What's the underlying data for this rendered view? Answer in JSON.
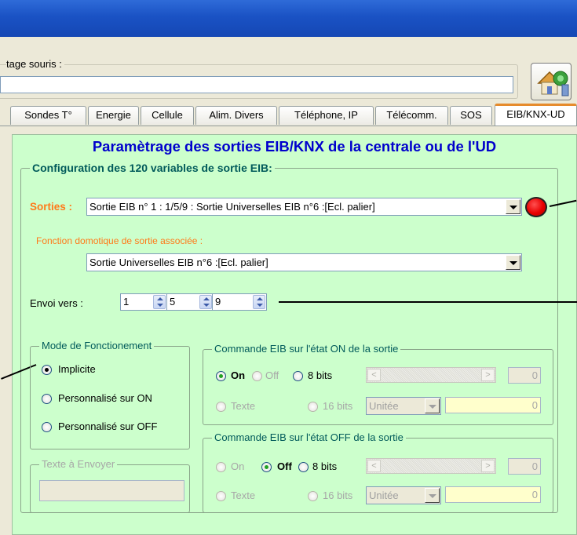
{
  "top": {
    "label": "tage souris :",
    "input_value": ""
  },
  "tabs": [
    {
      "label": "Sondes T°",
      "active": false
    },
    {
      "label": "Energie",
      "active": false
    },
    {
      "label": "Cellule",
      "active": false
    },
    {
      "label": "Alim. Divers",
      "active": false
    },
    {
      "label": "Téléphone, IP",
      "active": false
    },
    {
      "label": "Télécomm.",
      "active": false
    },
    {
      "label": "SOS",
      "active": false
    },
    {
      "label": "EIB/KNX-UD",
      "active": true
    }
  ],
  "panel": {
    "title": "Paramètrage des sorties EIB/KNX de la centrale ou de l'UD",
    "config_group_label": "Configuration des 120 variables de sortie EIB:",
    "sorties_label": "Sorties :",
    "sorties_value": "Sortie EIB n° 1 : 1/5/9 : Sortie Universelles EIB n°6 :[Ecl. palier]",
    "status_led_color": "#e80000",
    "fonction_label": "Fonction domotique de sortie associée :",
    "fonction_value": "Sortie Universelles EIB n°6 :[Ecl. palier]",
    "envoi_label": "Envoi vers :",
    "envoi_values": [
      "1",
      "5",
      "9"
    ],
    "mode": {
      "label": "Mode de Fonctionement",
      "options": [
        "Implicite",
        "Personnalisé sur ON",
        "Personnalisé sur OFF"
      ],
      "selected": "Implicite"
    },
    "texte_envoyer": {
      "label": "Texte à Envoyer",
      "value": ""
    },
    "cmd_on": {
      "label": "Commande EIB sur l'état  ON de la sortie",
      "on": "On",
      "off": "Off",
      "bits8": "8 bits",
      "texte": "Texte",
      "bits16": "16 bits",
      "unit": "Unitée",
      "value8": "0",
      "value16": "0",
      "selected": "On"
    },
    "cmd_off": {
      "label": "Commande EIB sur l'état  OFF de la sortie",
      "on": "On",
      "off": "Off",
      "bits8": "8 bits",
      "texte": "Texte",
      "bits16": "16 bits",
      "unit": "Unitée",
      "value8": "0",
      "value16": "0",
      "selected": "Off"
    }
  },
  "colors": {
    "panel_bg": "#ccffcc",
    "title": "#0000cc",
    "group_label": "#005a5a",
    "orange_label": "#ff7a1a",
    "titlebar": "#1a52c4"
  }
}
